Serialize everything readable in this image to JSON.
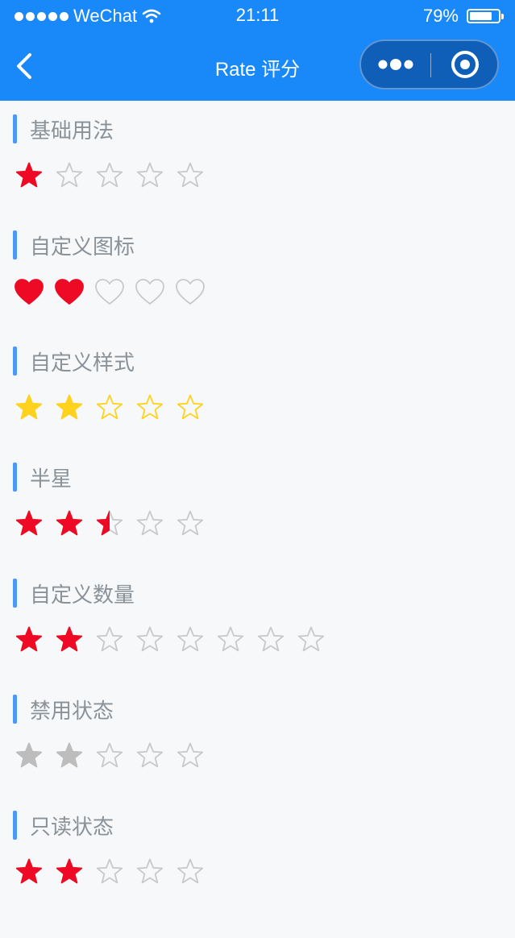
{
  "status": {
    "carrier": "WeChat",
    "time": "21:11",
    "battery": "79%",
    "battery_level": 0.79
  },
  "nav": {
    "title": "Rate 评分"
  },
  "colors": {
    "primary": "#1989fa",
    "red": "#ee0a24",
    "yellow": "#ffd21e",
    "gray_fill": "#bdbdbd",
    "void": "#c8c9cc"
  },
  "sections": [
    {
      "title": "基础用法",
      "icon": "star",
      "count": 5,
      "value": 1,
      "style": "default"
    },
    {
      "title": "自定义图标",
      "icon": "heart",
      "count": 5,
      "value": 2,
      "style": "default"
    },
    {
      "title": "自定义样式",
      "icon": "star",
      "count": 5,
      "value": 2,
      "style": "yellow"
    },
    {
      "title": "半星",
      "icon": "star",
      "count": 5,
      "value": 2.5,
      "style": "default"
    },
    {
      "title": "自定义数量",
      "icon": "star",
      "count": 8,
      "value": 2,
      "style": "default"
    },
    {
      "title": "禁用状态",
      "icon": "star",
      "count": 5,
      "value": 2,
      "style": "disabled"
    },
    {
      "title": "只读状态",
      "icon": "star",
      "count": 5,
      "value": 2,
      "style": "readonly"
    }
  ]
}
